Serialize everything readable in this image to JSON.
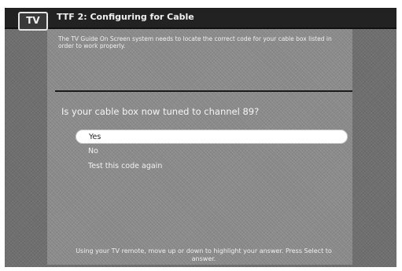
{
  "logo": {
    "text": "TV"
  },
  "header": {
    "title": "TTF 2: Configuring for Cable"
  },
  "intro": {
    "text": "The TV Guide On Screen system needs to locate the correct code for your cable box listed in order to work properly."
  },
  "question": {
    "text": "Is your cable box now tuned to channel 89?"
  },
  "options": [
    {
      "label": "Yes",
      "selected": true
    },
    {
      "label": "No",
      "selected": false
    },
    {
      "label": "Test this code again",
      "selected": false
    }
  ],
  "footer": {
    "text": "Using your TV remote, move up or down to highlight your answer. Press Select to answer."
  }
}
